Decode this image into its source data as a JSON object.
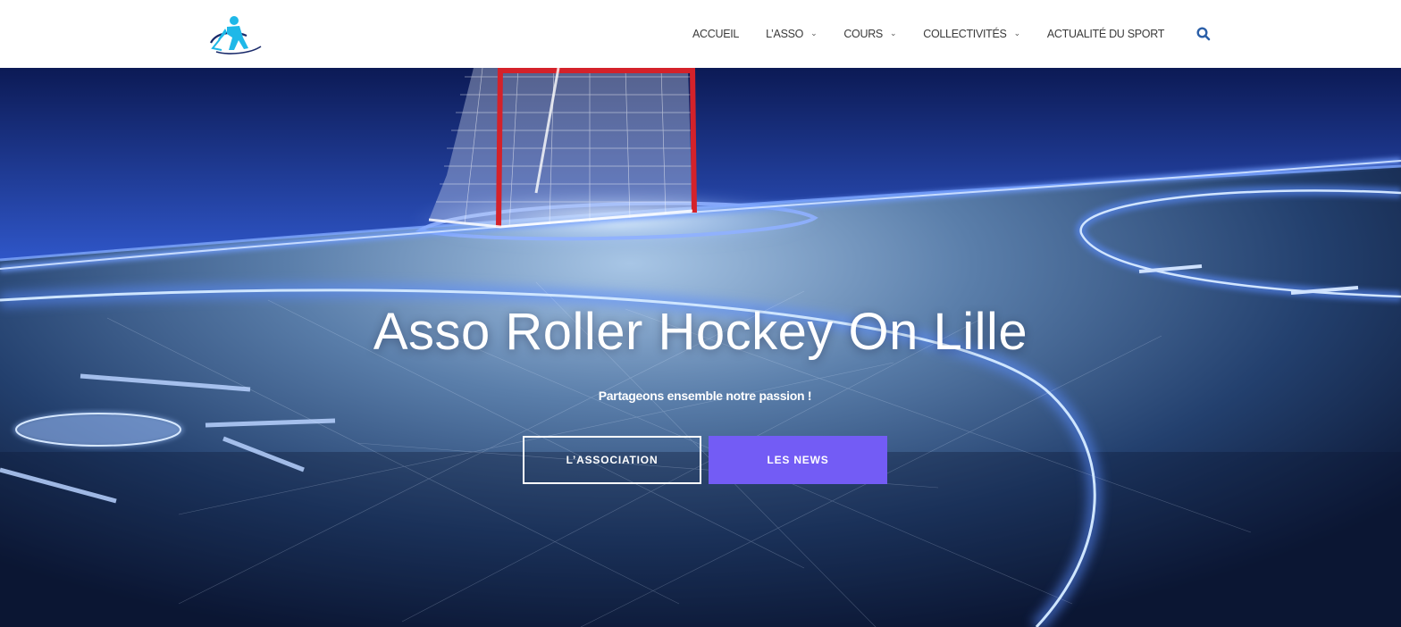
{
  "header": {
    "nav": [
      {
        "label": "ACCUEIL",
        "has_dropdown": false
      },
      {
        "label": "L’ASSO",
        "has_dropdown": true
      },
      {
        "label": "COURS",
        "has_dropdown": true
      },
      {
        "label": "COLLECTIVITÉS",
        "has_dropdown": true
      },
      {
        "label": "ACTUALITÉ DU SPORT",
        "has_dropdown": false
      }
    ],
    "search_icon": "search-icon",
    "search_color": "#2b5fa8",
    "logo_color": "#1fb8e8"
  },
  "hero": {
    "title": "Asso Roller Hockey On Lille",
    "subtitle": "Partageons ensemble notre passion !",
    "buttons": {
      "primary_label": "L’ASSOCIATION",
      "secondary_label": "LES NEWS"
    },
    "accent_color": "#735cf5"
  }
}
